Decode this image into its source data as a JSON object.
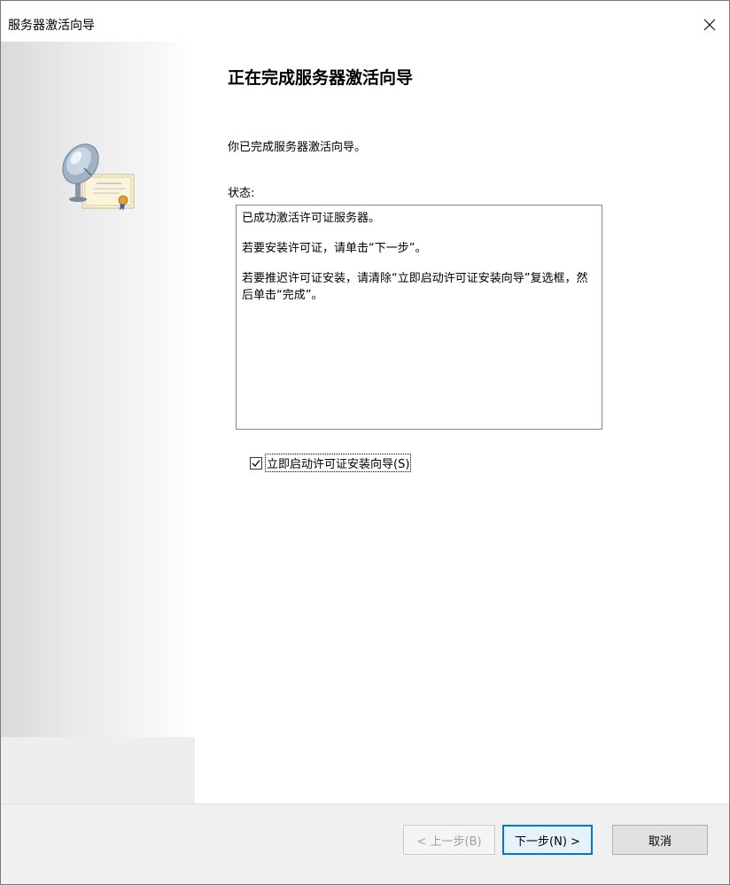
{
  "window": {
    "title": "服务器激活向导"
  },
  "main": {
    "heading": "正在完成服务器激活向导",
    "intro": "你已完成服务器激活向导。",
    "status_label": "状态:",
    "status_lines": [
      "已成功激活许可证服务器。",
      "若要安装许可证，请单击“下一步”。",
      "若要推迟许可证安装，请清除“立即启动许可证安装向导”复选框，然后单击“完成”。"
    ],
    "checkbox": {
      "label": "立即启动许可证安装向导(S)",
      "checked": true
    }
  },
  "buttons": {
    "back": "< 上一步(B)",
    "next": "下一步(N) >",
    "cancel": "取消"
  },
  "colors": {
    "accent": "#0078d7",
    "disabled_text": "#a0a0a0"
  },
  "icons": {
    "wizard": "satellite-certificate-icon",
    "close": "close-icon",
    "check": "checkmark-icon"
  }
}
